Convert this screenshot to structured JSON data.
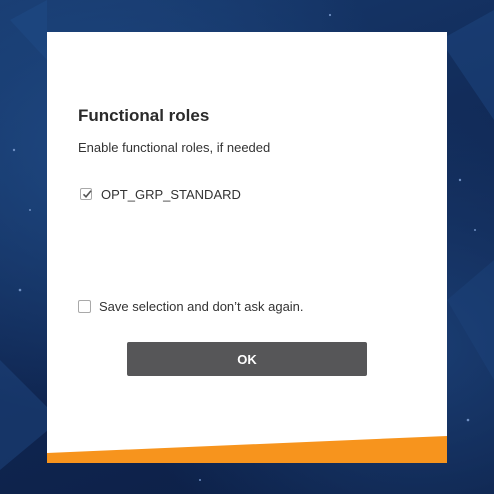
{
  "dialog": {
    "title": "Functional roles",
    "subtitle": "Enable functional roles, if needed",
    "roles": [
      {
        "label": "OPT_GRP_STANDARD",
        "checked": true
      }
    ],
    "save_selection_label": "Save selection and don’t ask again.",
    "save_selection_checked": false,
    "ok_label": "OK"
  },
  "colors": {
    "background": "#14305e",
    "dialog": "#ffffff",
    "button": "#565658",
    "accent": "#f7941d"
  }
}
